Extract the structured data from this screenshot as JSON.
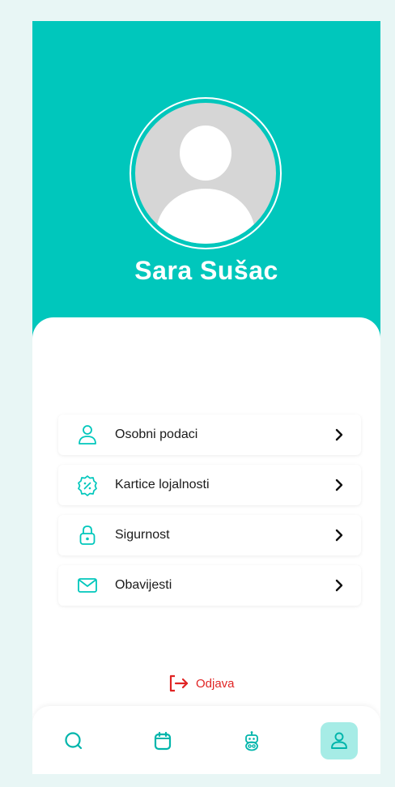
{
  "profile": {
    "name": "Sara Sušac"
  },
  "menu": {
    "items": [
      {
        "label": "Osobni podaci",
        "icon": "user-icon"
      },
      {
        "label": "Kartice lojalnosti",
        "icon": "discount-badge-icon"
      },
      {
        "label": "Sigurnost",
        "icon": "lock-icon"
      },
      {
        "label": "Obavijesti",
        "icon": "mail-icon"
      }
    ]
  },
  "logout": {
    "label": "Odjava",
    "icon": "logout-icon"
  },
  "tabbar": {
    "tabs": [
      {
        "icon": "search-icon",
        "active": false
      },
      {
        "icon": "calendar-icon",
        "active": false
      },
      {
        "icon": "robot-icon",
        "active": false
      },
      {
        "icon": "user-icon",
        "active": true
      }
    ]
  },
  "colors": {
    "accent": "#00c7bc",
    "accent_light": "#a6ece6",
    "page_bg": "#e8f6f5",
    "danger": "#e02424",
    "text": "#1a1a1a"
  }
}
